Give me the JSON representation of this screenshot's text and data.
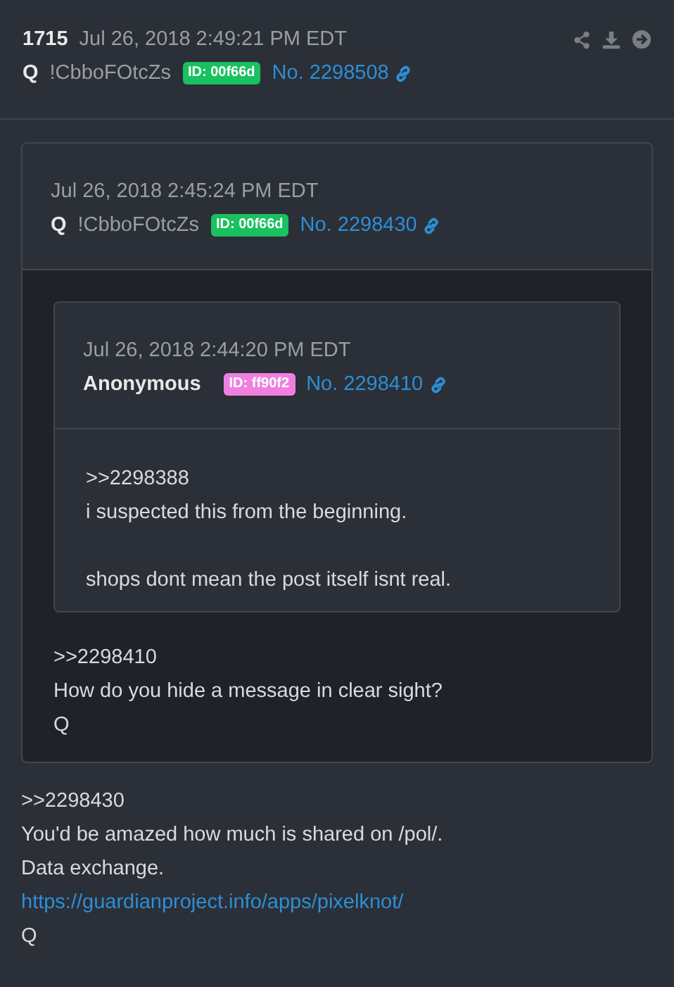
{
  "post": {
    "number": "1715",
    "date": "Jul 26, 2018 2:49:21 PM EDT",
    "author": "Q",
    "tripcode": "!CbboFOtcZs",
    "id_badge": {
      "text": "ID: 00f66d",
      "color": "#19c15f"
    },
    "post_no": "No. 2298508",
    "quote": {
      "date": "Jul 26, 2018 2:45:24 PM EDT",
      "author": "Q",
      "tripcode": "!CbboFOtcZs",
      "id_badge": {
        "text": "ID: 00f66d",
        "color": "#19c15f"
      },
      "post_no": "No. 2298430",
      "quote": {
        "date": "Jul 26, 2018 2:44:20 PM EDT",
        "author": "Anonymous",
        "id_badge": {
          "text": "ID: ff90f2",
          "color": "#f080e0"
        },
        "post_no": "No. 2298410",
        "paragraphs": [
          [
            {
              "kind": "text",
              "text": ">>2298388"
            },
            {
              "kind": "text",
              "text": "i suspected this from the beginning."
            }
          ],
          [
            {
              "kind": "text",
              "text": "shops dont mean the post itself isnt real."
            }
          ]
        ]
      },
      "paragraphs": [
        [
          {
            "kind": "text",
            "text": ">>2298410"
          },
          {
            "kind": "text",
            "text": "How do you hide a message in clear sight?"
          },
          {
            "kind": "text",
            "text": "Q"
          }
        ]
      ]
    },
    "paragraphs": [
      [
        {
          "kind": "text",
          "text": ">>2298430"
        },
        {
          "kind": "text",
          "text": "You'd be amazed how much is shared on /pol/."
        },
        {
          "kind": "text",
          "text": "Data exchange."
        },
        {
          "kind": "link",
          "text": "https://guardianproject.info/apps/pixelknot/"
        },
        {
          "kind": "text",
          "text": "Q"
        }
      ]
    ]
  }
}
